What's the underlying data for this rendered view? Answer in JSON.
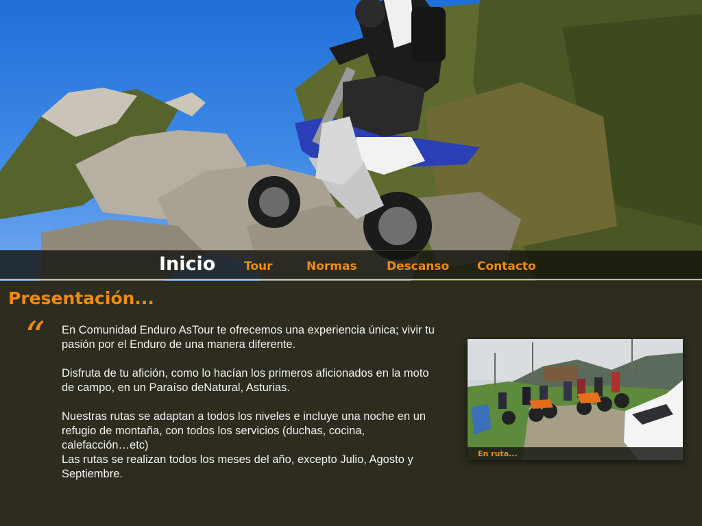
{
  "nav": {
    "active": "Inicio",
    "items": [
      "Tour",
      "Normas",
      "Descanso",
      "Contacto"
    ]
  },
  "section": {
    "title": "Presentación...",
    "quote_mark": "“"
  },
  "content": {
    "p1": "En Comunidad Enduro AsTour te ofrecemos una experiencia única; vivir tu pasión por el Enduro de una manera diferente.",
    "p2": "Disfruta de tu afición, como lo hacían los primeros aficionados en la moto de campo, en un Paraíso deNatural, Asturias.",
    "p3": "Nuestras rutas se adaptan a todos los niveles e incluye una noche en un refugio de montaña, con todos los servicios (duchas, cocina, calefacción…etc)",
    "p4": "Las rutas se realizan todos los meses del año, excepto Julio, Agosto y Septiembre."
  },
  "photo": {
    "caption": "En ruta..."
  },
  "colors": {
    "accent": "#ef8a12",
    "background": "#2d2c1f",
    "nav_background": "#14140e",
    "text": "#f2f2f2"
  }
}
